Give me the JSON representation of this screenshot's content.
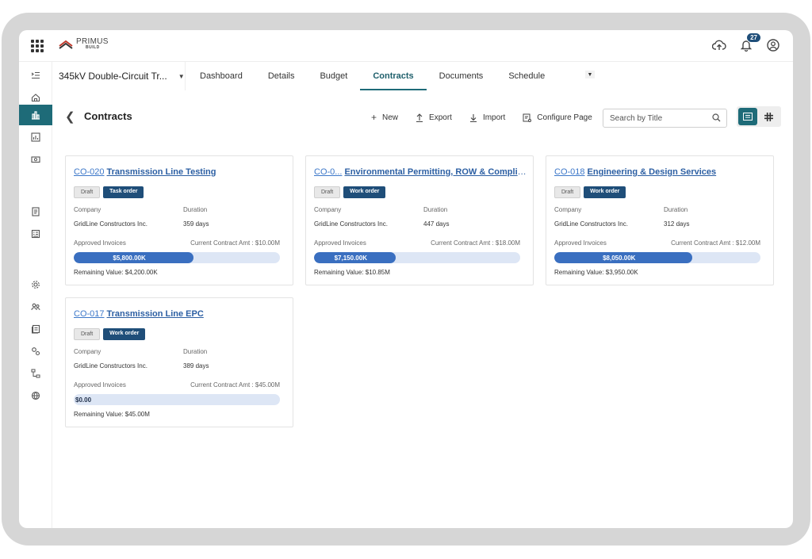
{
  "app": {
    "logo_line1": "PRIMUS",
    "logo_line2": "BUILD",
    "notification_count": "27"
  },
  "project": {
    "name": "345kV Double-Circuit Tr..."
  },
  "tabs": [
    {
      "label": "Dashboard",
      "active": false
    },
    {
      "label": "Details",
      "active": false
    },
    {
      "label": "Budget",
      "active": false
    },
    {
      "label": "Contracts",
      "active": true
    },
    {
      "label": "Documents",
      "active": false
    },
    {
      "label": "Schedule",
      "active": false
    }
  ],
  "page": {
    "title": "Contracts"
  },
  "toolbar": {
    "new_label": "New",
    "export_label": "Export",
    "import_label": "Import",
    "configure_label": "Configure Page"
  },
  "search": {
    "placeholder": "Search by Title"
  },
  "labels": {
    "company": "Company",
    "duration": "Duration",
    "approved_invoices": "Approved Invoices"
  },
  "contracts": [
    {
      "code": "CO-020",
      "title": "Transmission Line Testing",
      "status": "Draft",
      "type": "Task order",
      "company": "GridLine Constructors Inc.",
      "duration": "359 days",
      "current_amount": "Current Contract Amt : $10.00M",
      "approved": "$5,800.00K",
      "progress": 0.58,
      "remaining": "Remaining Value: $4,200.00K"
    },
    {
      "code": "CO-0...",
      "title": "Environmental Permitting, ROW & Compliance ...",
      "status": "Draft",
      "type": "Work order",
      "company": "GridLine Constructors Inc.",
      "duration": "447 days",
      "current_amount": "Current Contract Amt : $18.00M",
      "approved": "$7,150.00K",
      "progress": 0.397,
      "remaining": "Remaining Value: $10.85M"
    },
    {
      "code": "CO-018",
      "title": "Engineering & Design Services",
      "status": "Draft",
      "type": "Work order",
      "company": "GridLine Constructors Inc.",
      "duration": "312 days",
      "current_amount": "Current Contract Amt : $12.00M",
      "approved": "$8,050.00K",
      "progress": 0.67,
      "remaining": "Remaining Value: $3,950.00K"
    },
    {
      "code": "CO-017",
      "title": "Transmission Line EPC",
      "status": "Draft",
      "type": "Work order",
      "company": "GridLine Constructors Inc.",
      "duration": "389 days",
      "current_amount": "Current Contract Amt : $45.00M",
      "approved": "$0.00",
      "progress": 0,
      "remaining": "Remaining Value: $45.00M"
    }
  ]
}
